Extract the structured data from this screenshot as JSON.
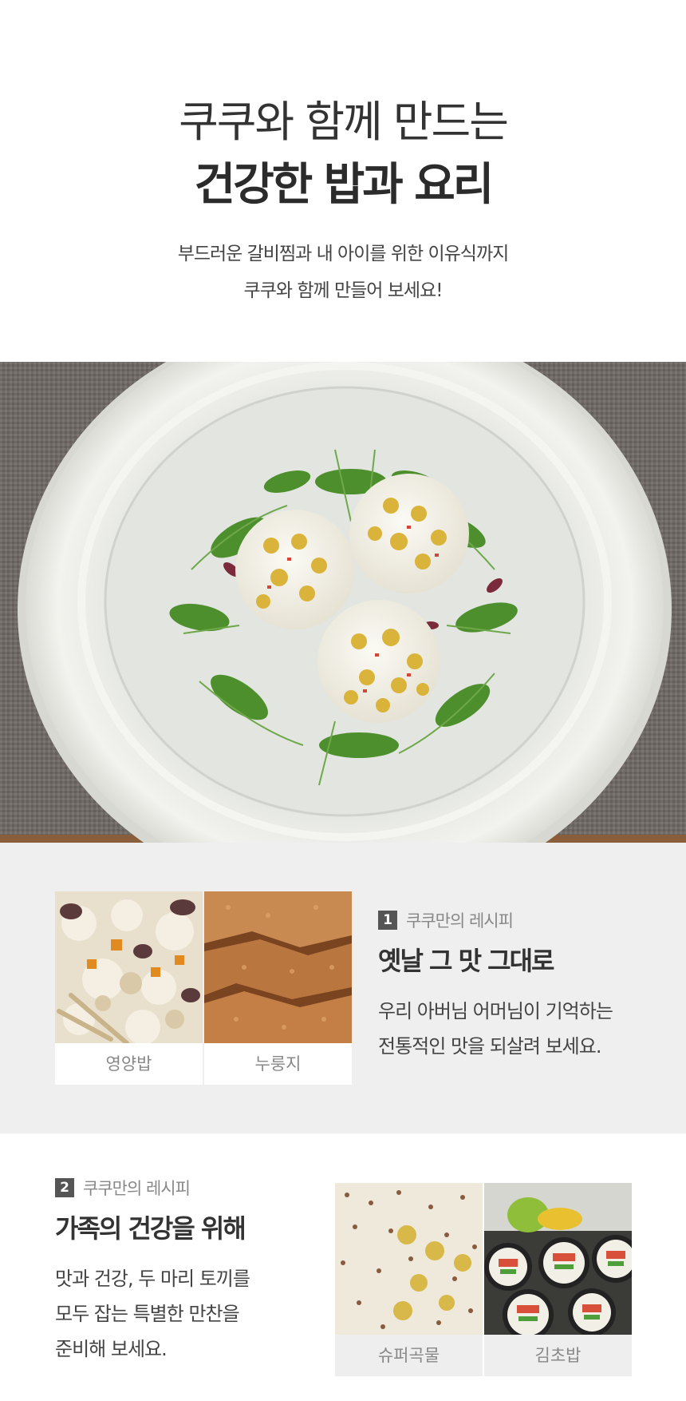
{
  "hero": {
    "title_line1": "쿠쿠와 함께 만드는",
    "title_line2": "건강한 밥과 요리",
    "description_line1": "부드러운 갈비찜과 내 아이를 위한 이유식까지",
    "description_line2": "쿠쿠와 함께 만들어 보세요!"
  },
  "recipe_1": {
    "badge_number": "1",
    "badge_label": "쿠쿠만의 레시피",
    "title": "옛날 그 맛 그대로",
    "description_line1": "우리 아버님 어머님이 기억하는",
    "description_line2": "전통적인 맛을 되살려 보세요.",
    "items": [
      {
        "label": "영양밥"
      },
      {
        "label": "누룽지"
      }
    ]
  },
  "recipe_2": {
    "badge_number": "2",
    "badge_label": "쿠쿠만의 레시피",
    "title": "가족의 건강을 위해",
    "description_line1": "맛과 건강, 두 마리 토끼를",
    "description_line2": "모두 잡는 특별한 만찬을",
    "description_line3": "준비해 보세요.",
    "items": [
      {
        "label": "슈퍼곡물"
      },
      {
        "label": "김초밥"
      }
    ]
  },
  "colors": {
    "section_bg": "#efefef",
    "badge_bg": "#555555",
    "text_dark": "#333333",
    "text_muted": "#888888"
  }
}
